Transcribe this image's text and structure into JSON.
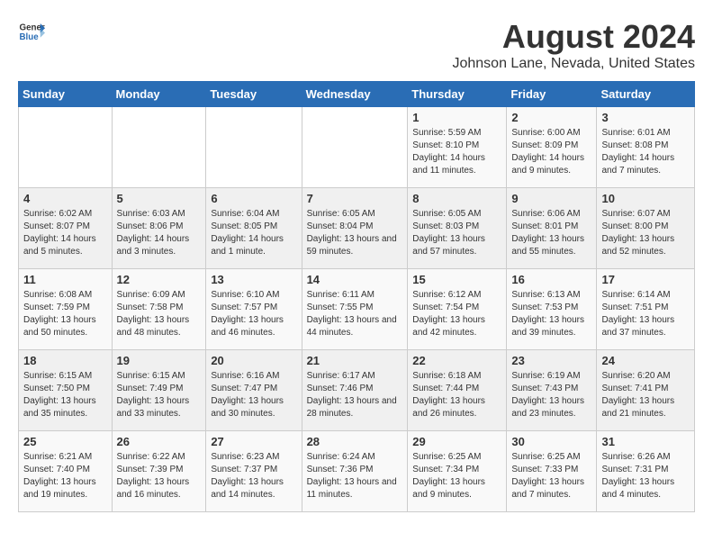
{
  "header": {
    "logo_general": "General",
    "logo_blue": "Blue",
    "title": "August 2024",
    "subtitle": "Johnson Lane, Nevada, United States"
  },
  "calendar": {
    "days_of_week": [
      "Sunday",
      "Monday",
      "Tuesday",
      "Wednesday",
      "Thursday",
      "Friday",
      "Saturday"
    ],
    "weeks": [
      {
        "days": [
          {
            "num": "",
            "sunrise": "",
            "sunset": "",
            "daylight": ""
          },
          {
            "num": "",
            "sunrise": "",
            "sunset": "",
            "daylight": ""
          },
          {
            "num": "",
            "sunrise": "",
            "sunset": "",
            "daylight": ""
          },
          {
            "num": "",
            "sunrise": "",
            "sunset": "",
            "daylight": ""
          },
          {
            "num": "1",
            "sunrise": "Sunrise: 5:59 AM",
            "sunset": "Sunset: 8:10 PM",
            "daylight": "Daylight: 14 hours and 11 minutes."
          },
          {
            "num": "2",
            "sunrise": "Sunrise: 6:00 AM",
            "sunset": "Sunset: 8:09 PM",
            "daylight": "Daylight: 14 hours and 9 minutes."
          },
          {
            "num": "3",
            "sunrise": "Sunrise: 6:01 AM",
            "sunset": "Sunset: 8:08 PM",
            "daylight": "Daylight: 14 hours and 7 minutes."
          }
        ]
      },
      {
        "days": [
          {
            "num": "4",
            "sunrise": "Sunrise: 6:02 AM",
            "sunset": "Sunset: 8:07 PM",
            "daylight": "Daylight: 14 hours and 5 minutes."
          },
          {
            "num": "5",
            "sunrise": "Sunrise: 6:03 AM",
            "sunset": "Sunset: 8:06 PM",
            "daylight": "Daylight: 14 hours and 3 minutes."
          },
          {
            "num": "6",
            "sunrise": "Sunrise: 6:04 AM",
            "sunset": "Sunset: 8:05 PM",
            "daylight": "Daylight: 14 hours and 1 minute."
          },
          {
            "num": "7",
            "sunrise": "Sunrise: 6:05 AM",
            "sunset": "Sunset: 8:04 PM",
            "daylight": "Daylight: 13 hours and 59 minutes."
          },
          {
            "num": "8",
            "sunrise": "Sunrise: 6:05 AM",
            "sunset": "Sunset: 8:03 PM",
            "daylight": "Daylight: 13 hours and 57 minutes."
          },
          {
            "num": "9",
            "sunrise": "Sunrise: 6:06 AM",
            "sunset": "Sunset: 8:01 PM",
            "daylight": "Daylight: 13 hours and 55 minutes."
          },
          {
            "num": "10",
            "sunrise": "Sunrise: 6:07 AM",
            "sunset": "Sunset: 8:00 PM",
            "daylight": "Daylight: 13 hours and 52 minutes."
          }
        ]
      },
      {
        "days": [
          {
            "num": "11",
            "sunrise": "Sunrise: 6:08 AM",
            "sunset": "Sunset: 7:59 PM",
            "daylight": "Daylight: 13 hours and 50 minutes."
          },
          {
            "num": "12",
            "sunrise": "Sunrise: 6:09 AM",
            "sunset": "Sunset: 7:58 PM",
            "daylight": "Daylight: 13 hours and 48 minutes."
          },
          {
            "num": "13",
            "sunrise": "Sunrise: 6:10 AM",
            "sunset": "Sunset: 7:57 PM",
            "daylight": "Daylight: 13 hours and 46 minutes."
          },
          {
            "num": "14",
            "sunrise": "Sunrise: 6:11 AM",
            "sunset": "Sunset: 7:55 PM",
            "daylight": "Daylight: 13 hours and 44 minutes."
          },
          {
            "num": "15",
            "sunrise": "Sunrise: 6:12 AM",
            "sunset": "Sunset: 7:54 PM",
            "daylight": "Daylight: 13 hours and 42 minutes."
          },
          {
            "num": "16",
            "sunrise": "Sunrise: 6:13 AM",
            "sunset": "Sunset: 7:53 PM",
            "daylight": "Daylight: 13 hours and 39 minutes."
          },
          {
            "num": "17",
            "sunrise": "Sunrise: 6:14 AM",
            "sunset": "Sunset: 7:51 PM",
            "daylight": "Daylight: 13 hours and 37 minutes."
          }
        ]
      },
      {
        "days": [
          {
            "num": "18",
            "sunrise": "Sunrise: 6:15 AM",
            "sunset": "Sunset: 7:50 PM",
            "daylight": "Daylight: 13 hours and 35 minutes."
          },
          {
            "num": "19",
            "sunrise": "Sunrise: 6:15 AM",
            "sunset": "Sunset: 7:49 PM",
            "daylight": "Daylight: 13 hours and 33 minutes."
          },
          {
            "num": "20",
            "sunrise": "Sunrise: 6:16 AM",
            "sunset": "Sunset: 7:47 PM",
            "daylight": "Daylight: 13 hours and 30 minutes."
          },
          {
            "num": "21",
            "sunrise": "Sunrise: 6:17 AM",
            "sunset": "Sunset: 7:46 PM",
            "daylight": "Daylight: 13 hours and 28 minutes."
          },
          {
            "num": "22",
            "sunrise": "Sunrise: 6:18 AM",
            "sunset": "Sunset: 7:44 PM",
            "daylight": "Daylight: 13 hours and 26 minutes."
          },
          {
            "num": "23",
            "sunrise": "Sunrise: 6:19 AM",
            "sunset": "Sunset: 7:43 PM",
            "daylight": "Daylight: 13 hours and 23 minutes."
          },
          {
            "num": "24",
            "sunrise": "Sunrise: 6:20 AM",
            "sunset": "Sunset: 7:41 PM",
            "daylight": "Daylight: 13 hours and 21 minutes."
          }
        ]
      },
      {
        "days": [
          {
            "num": "25",
            "sunrise": "Sunrise: 6:21 AM",
            "sunset": "Sunset: 7:40 PM",
            "daylight": "Daylight: 13 hours and 19 minutes."
          },
          {
            "num": "26",
            "sunrise": "Sunrise: 6:22 AM",
            "sunset": "Sunset: 7:39 PM",
            "daylight": "Daylight: 13 hours and 16 minutes."
          },
          {
            "num": "27",
            "sunrise": "Sunrise: 6:23 AM",
            "sunset": "Sunset: 7:37 PM",
            "daylight": "Daylight: 13 hours and 14 minutes."
          },
          {
            "num": "28",
            "sunrise": "Sunrise: 6:24 AM",
            "sunset": "Sunset: 7:36 PM",
            "daylight": "Daylight: 13 hours and 11 minutes."
          },
          {
            "num": "29",
            "sunrise": "Sunrise: 6:25 AM",
            "sunset": "Sunset: 7:34 PM",
            "daylight": "Daylight: 13 hours and 9 minutes."
          },
          {
            "num": "30",
            "sunrise": "Sunrise: 6:25 AM",
            "sunset": "Sunset: 7:33 PM",
            "daylight": "Daylight: 13 hours and 7 minutes."
          },
          {
            "num": "31",
            "sunrise": "Sunrise: 6:26 AM",
            "sunset": "Sunset: 7:31 PM",
            "daylight": "Daylight: 13 hours and 4 minutes."
          }
        ]
      }
    ]
  }
}
